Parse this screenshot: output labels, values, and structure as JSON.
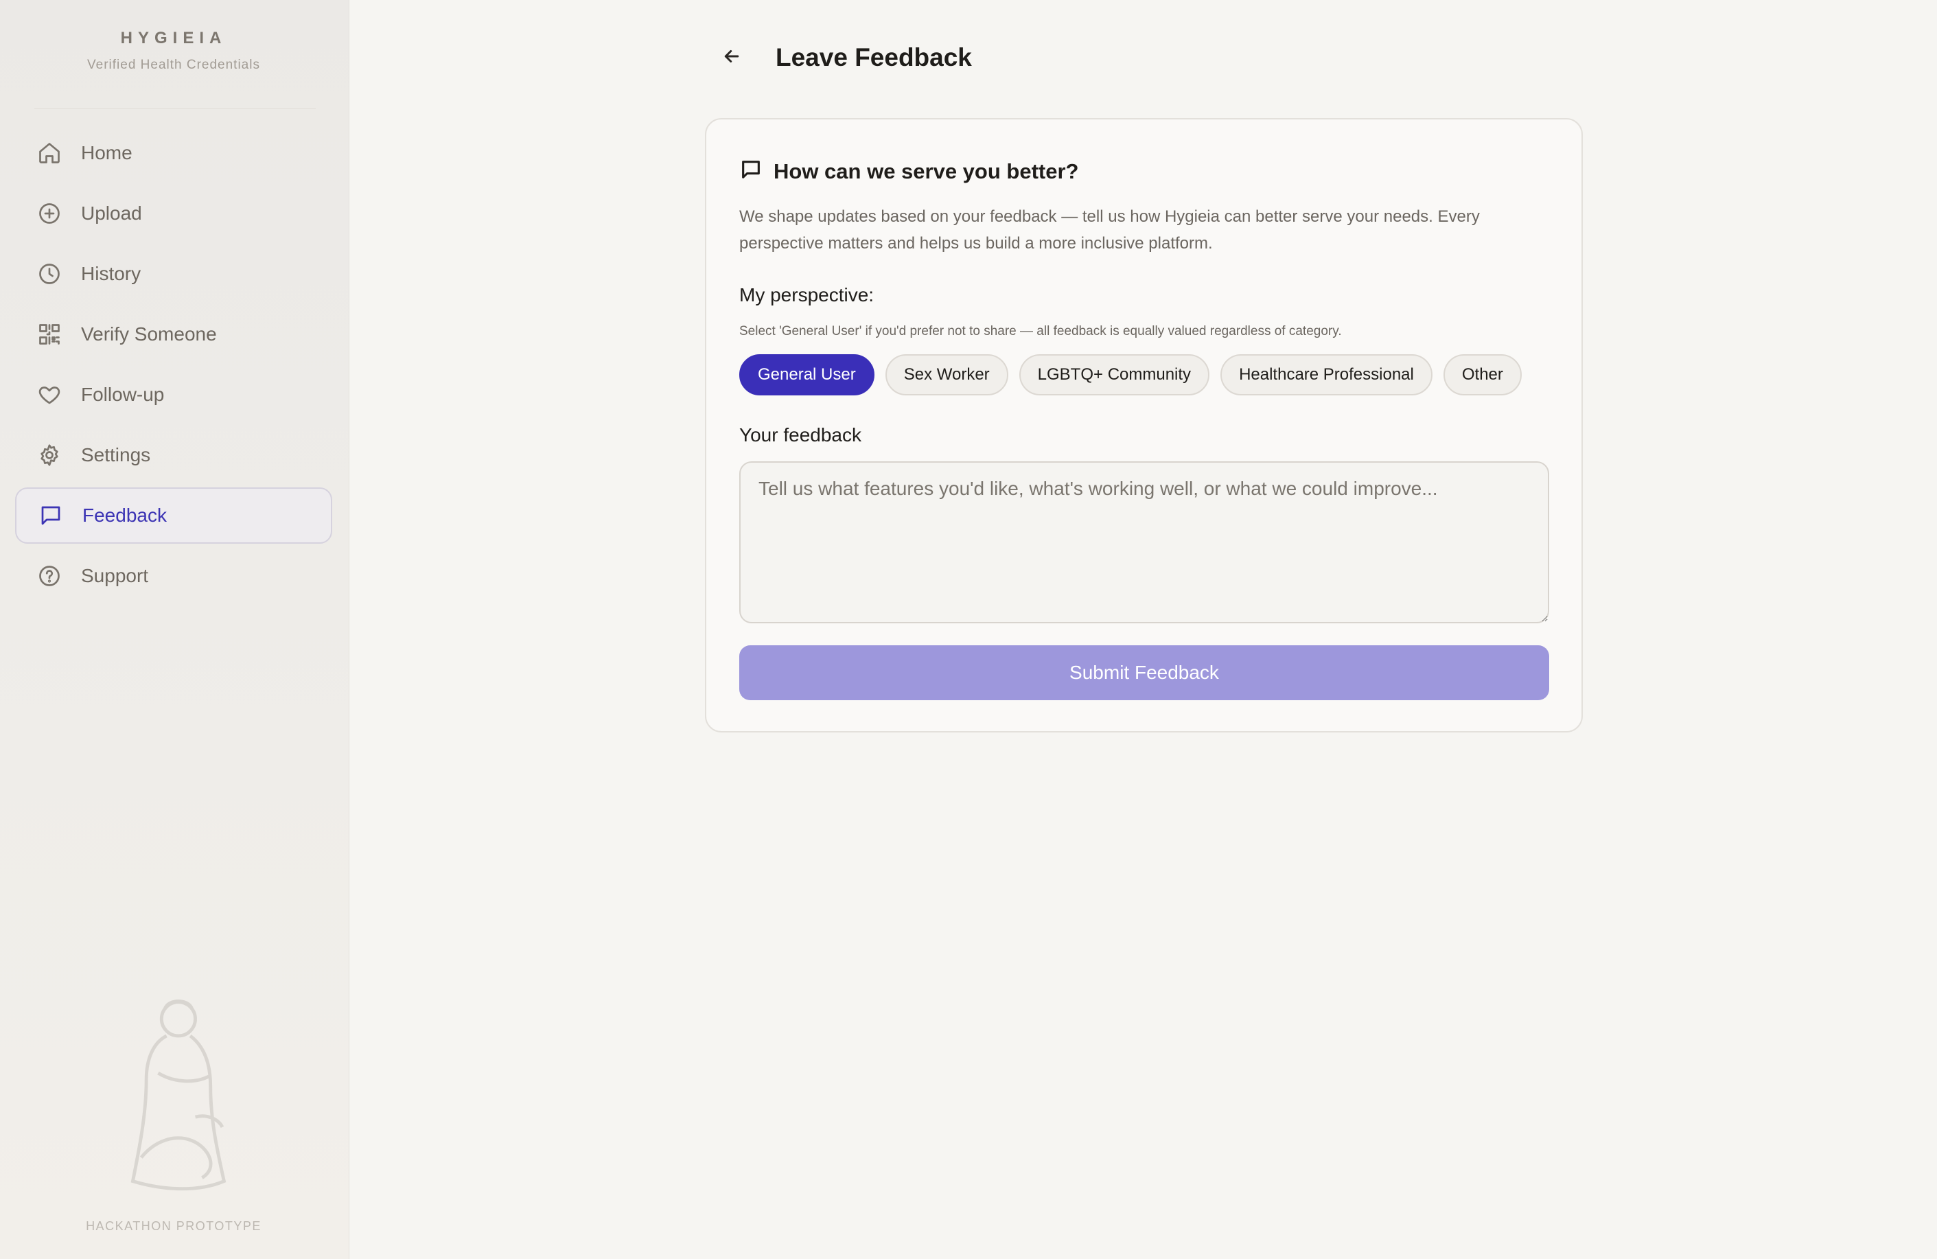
{
  "brand": {
    "name": "HYGIEIA",
    "tagline": "Verified Health Credentials"
  },
  "sidebar": {
    "items": [
      {
        "label": "Home",
        "icon": "home-icon",
        "active": false
      },
      {
        "label": "Upload",
        "icon": "plus-circle-icon",
        "active": false
      },
      {
        "label": "History",
        "icon": "clock-icon",
        "active": false
      },
      {
        "label": "Verify Someone",
        "icon": "qr-code-icon",
        "active": false
      },
      {
        "label": "Follow-up",
        "icon": "heart-icon",
        "active": false
      },
      {
        "label": "Settings",
        "icon": "gear-icon",
        "active": false
      },
      {
        "label": "Feedback",
        "icon": "message-square-icon",
        "active": true
      },
      {
        "label": "Support",
        "icon": "help-circle-icon",
        "active": false
      }
    ],
    "footer": "HACKATHON PROTOTYPE"
  },
  "header": {
    "title": "Leave Feedback",
    "back_icon": "arrow-left-icon"
  },
  "card": {
    "heading": "How can we serve you better?",
    "heading_icon": "message-square-icon",
    "description": "We shape updates based on your feedback — tell us how Hygieia can better serve your needs. Every perspective matters and helps us build a more inclusive platform.",
    "perspective_label": "My perspective:",
    "perspective_hint": "Select 'General User' if you'd prefer not to share — all feedback is equally valued regardless of category.",
    "perspectives": [
      {
        "label": "General User",
        "selected": true
      },
      {
        "label": "Sex Worker",
        "selected": false
      },
      {
        "label": "LGBTQ+ Community",
        "selected": false
      },
      {
        "label": "Healthcare Professional",
        "selected": false
      },
      {
        "label": "Other",
        "selected": false
      }
    ],
    "feedback_label": "Your feedback",
    "feedback_value": "",
    "feedback_placeholder": "Tell us what features you'd like, what's working well, or what we could improve...",
    "submit_label": "Submit Feedback"
  },
  "colors": {
    "accent": "#3a2fb8",
    "submit_disabled": "#9d97dc",
    "background": "#f6f5f2"
  }
}
